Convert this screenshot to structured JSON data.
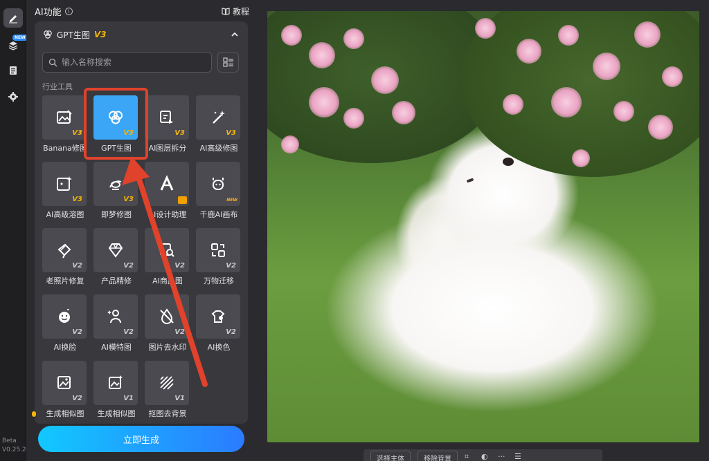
{
  "rail": {
    "new_badge": "NEW",
    "version_line1": "Beta",
    "version_line2": "V0.25.2"
  },
  "panel": {
    "title": "AI功能",
    "tutorial": "教程",
    "card_title": "GPT生图",
    "card_version": "V3",
    "search_placeholder": "输入名称搜索",
    "section_label": "行业工具",
    "generate_label": "立即生成"
  },
  "tools": [
    {
      "label": "Banana修图",
      "version": "V3",
      "icon": "image-edit-icon",
      "selected": false
    },
    {
      "label": "GPT生图",
      "version": "V3",
      "icon": "openai-logo-icon",
      "selected": true
    },
    {
      "label": "AI图层拆分",
      "version": "V3",
      "icon": "layers-split-icon",
      "selected": false
    },
    {
      "label": "AI高级修图",
      "version": "V3",
      "icon": "magic-wand-icon",
      "selected": false
    },
    {
      "label": "AI高级溶图",
      "version": "V3",
      "icon": "image-sparkle-icon",
      "selected": false
    },
    {
      "label": "即梦修图",
      "version": "V3",
      "icon": "dream-edit-icon",
      "selected": false
    },
    {
      "label": "AI设计助理",
      "version": "",
      "icon": "design-assistant-icon",
      "selected": false
    },
    {
      "label": "千鹿AI画布",
      "version": "NEW",
      "icon": "deer-canvas-icon",
      "selected": false
    },
    {
      "label": "老照片修复",
      "version": "V2",
      "icon": "photo-restore-icon",
      "selected": false
    },
    {
      "label": "产品精修",
      "version": "V2",
      "icon": "gem-icon",
      "selected": false
    },
    {
      "label": "AI商品图",
      "version": "V2",
      "icon": "product-search-icon",
      "selected": false
    },
    {
      "label": "万物迁移",
      "version": "V2",
      "icon": "transfer-icon",
      "selected": false
    },
    {
      "label": "AI换脸",
      "version": "V2",
      "icon": "face-swap-icon",
      "selected": false
    },
    {
      "label": "AI模特图",
      "version": "V2",
      "icon": "model-icon",
      "selected": false
    },
    {
      "label": "图片去水印",
      "version": "V2",
      "icon": "watermark-remove-icon",
      "selected": false
    },
    {
      "label": "AI换色",
      "version": "V2",
      "icon": "recolor-icon",
      "selected": false
    },
    {
      "label": "生成相似图",
      "version": "V2",
      "icon": "image-similar-icon",
      "selected": false
    },
    {
      "label": "生成相似图",
      "version": "V1",
      "icon": "image-similar-v1-icon",
      "selected": false
    },
    {
      "label": "抠图去背景",
      "version": "V1",
      "icon": "background-remove-icon",
      "selected": false
    }
  ],
  "bottom_toolbar": {
    "select_subject": "选择主体",
    "remove_background": "移除背景",
    "more": "···"
  },
  "colors": {
    "accent": "#3aa6f5",
    "highlight": "#e0422b",
    "version_gold": "#f2b30a"
  }
}
